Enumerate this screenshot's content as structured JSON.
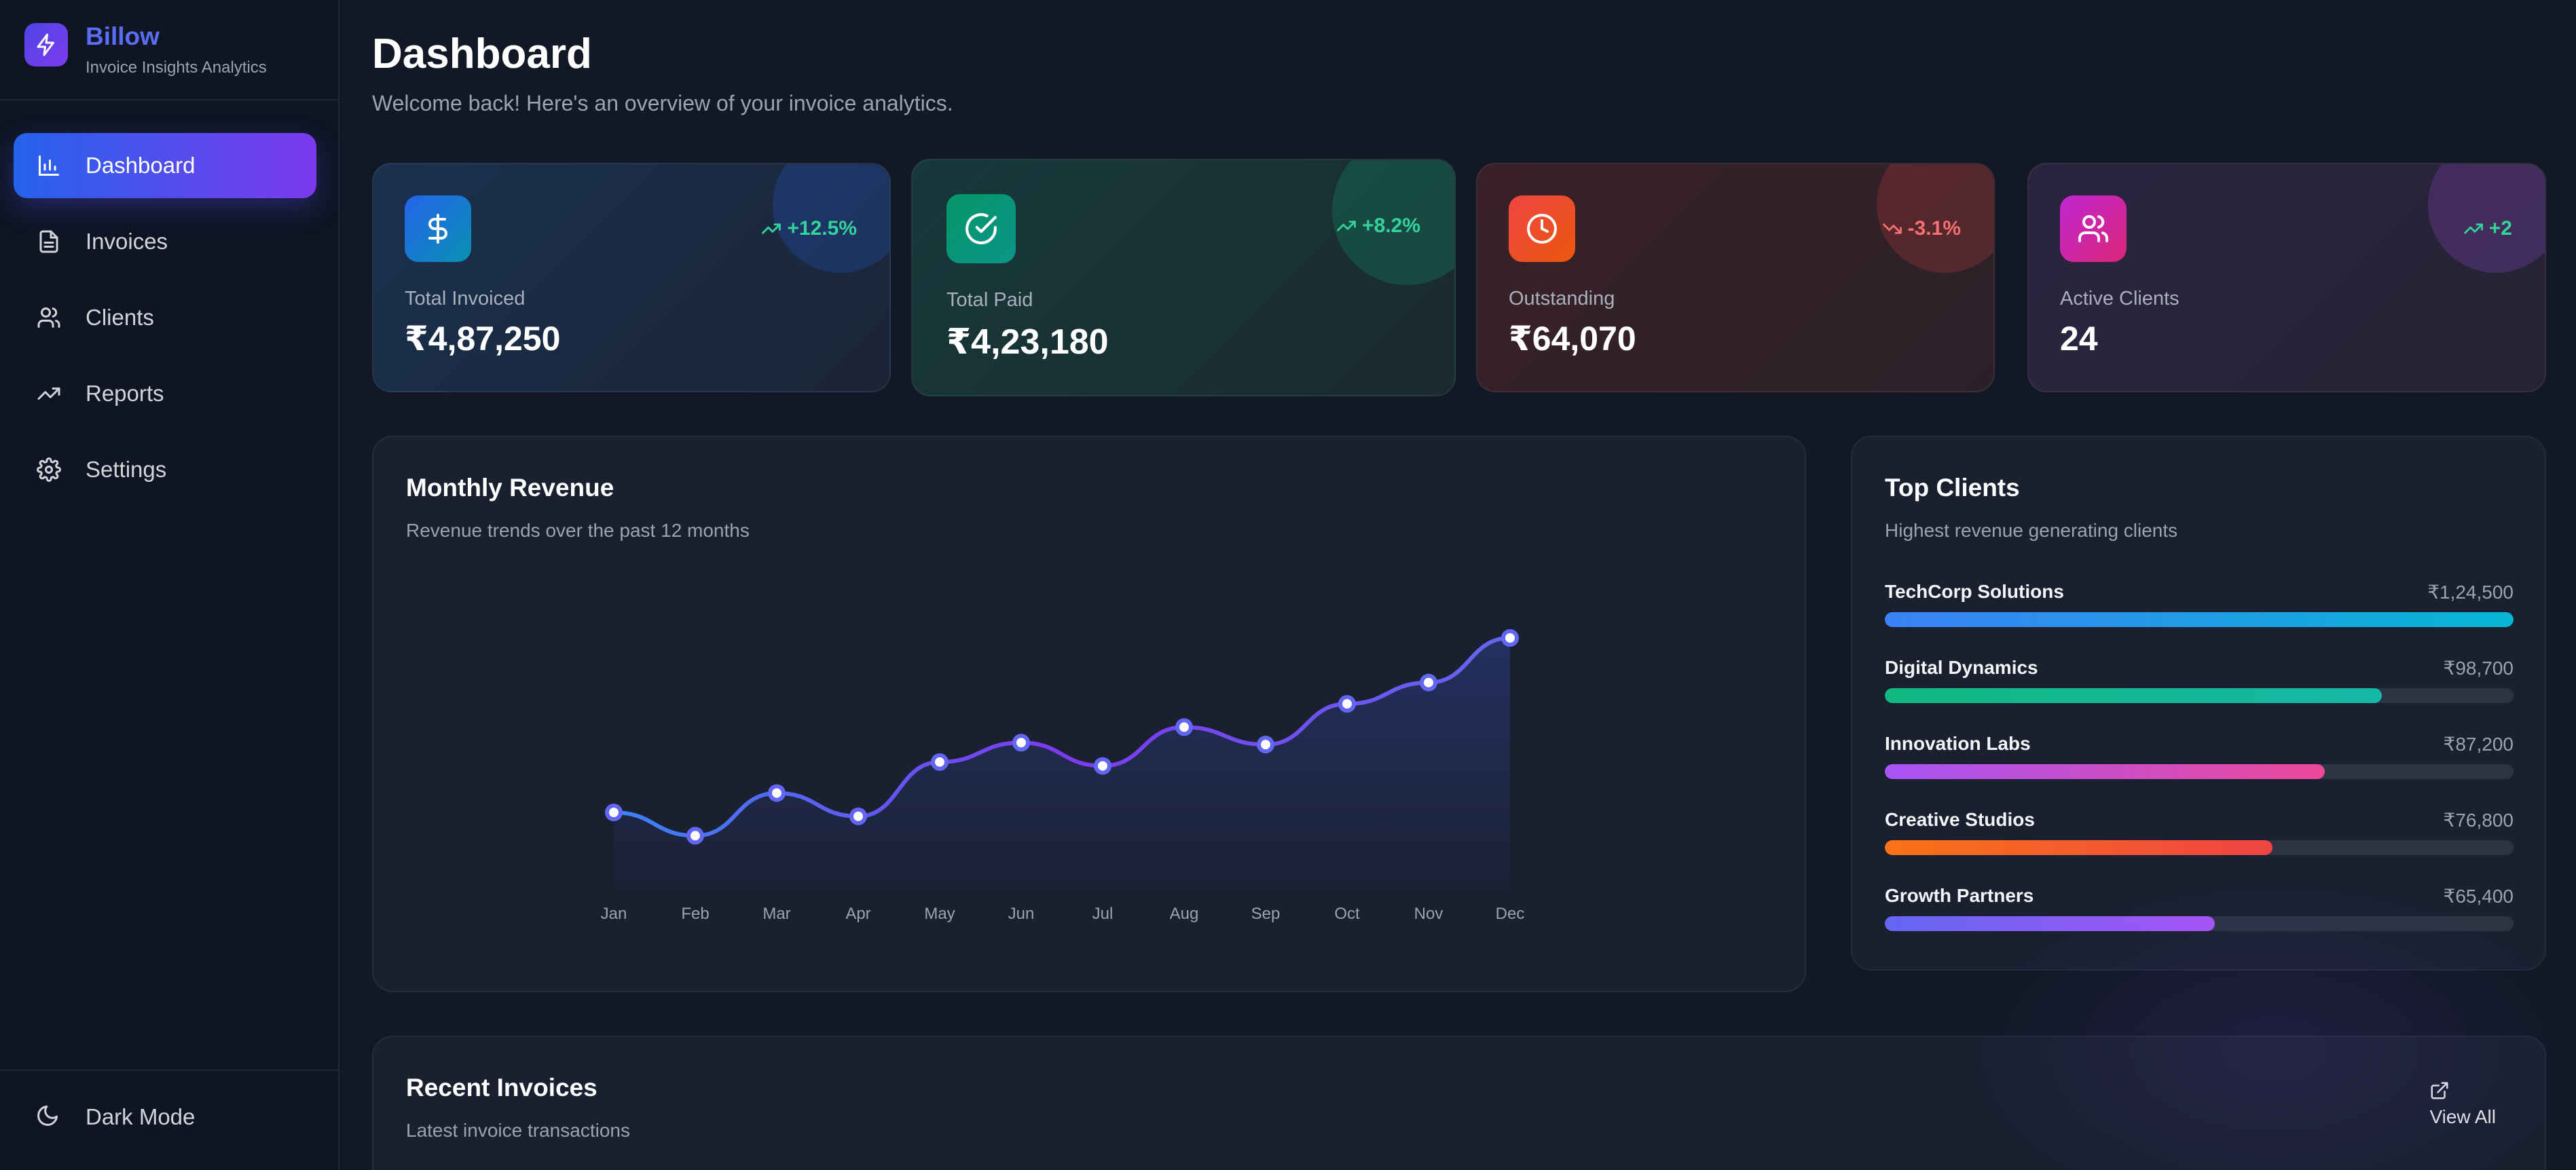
{
  "brand": {
    "name": "Billow",
    "subtitle": "Invoice Insights Analytics"
  },
  "sidebar": {
    "items": [
      {
        "label": "Dashboard",
        "icon": "bar-chart-icon",
        "active": true
      },
      {
        "label": "Invoices",
        "icon": "file-text-icon",
        "active": false
      },
      {
        "label": "Clients",
        "icon": "users-icon",
        "active": false
      },
      {
        "label": "Reports",
        "icon": "trending-up-icon",
        "active": false
      },
      {
        "label": "Settings",
        "icon": "gear-icon",
        "active": false
      }
    ],
    "dark_mode_label": "Dark Mode"
  },
  "header": {
    "title": "Dashboard",
    "subtitle": "Welcome back! Here's an overview of your invoice analytics."
  },
  "stats": [
    {
      "label": "Total Invoiced",
      "value": "₹4,87,250",
      "trend": "+12.5%",
      "trend_dir": "up",
      "icon": "dollar-icon",
      "color": "#2563eb"
    },
    {
      "label": "Total Paid",
      "value": "₹4,23,180",
      "trend": "+8.2%",
      "trend_dir": "up",
      "icon": "check-circle-icon",
      "color": "#10b981"
    },
    {
      "label": "Outstanding",
      "value": "₹64,070",
      "trend": "-3.1%",
      "trend_dir": "down",
      "icon": "clock-icon",
      "color": "#ef4444"
    },
    {
      "label": "Active Clients",
      "value": "24",
      "trend": "+2",
      "trend_dir": "up",
      "icon": "users-icon",
      "color": "#c026d3"
    }
  ],
  "revenue": {
    "title": "Monthly Revenue",
    "subtitle": "Revenue trends over the past 12 months"
  },
  "chart_data": {
    "type": "area",
    "categories": [
      "Jan",
      "Feb",
      "Mar",
      "Apr",
      "May",
      "Jun",
      "Jul",
      "Aug",
      "Sep",
      "Oct",
      "Nov",
      "Dec"
    ],
    "values": [
      48000,
      42000,
      53000,
      47000,
      61000,
      66000,
      60000,
      70000,
      65500,
      76000,
      81500,
      93000
    ],
    "title": "Monthly Revenue",
    "xlabel": "",
    "ylabel": "",
    "ylim": [
      30000,
      100000
    ],
    "grid": false,
    "color": "#6366f1"
  },
  "top_clients": {
    "title": "Top Clients",
    "subtitle": "Highest revenue generating clients",
    "items": [
      {
        "name": "TechCorp Solutions",
        "amount": "₹1,24,500",
        "fraction": 1.0,
        "from": "#3b82f6",
        "to": "#06b6d4"
      },
      {
        "name": "Digital Dynamics",
        "amount": "₹98,700",
        "fraction": 0.79,
        "from": "#10b981",
        "to": "#14b8a6"
      },
      {
        "name": "Innovation Labs",
        "amount": "₹87,200",
        "fraction": 0.7,
        "from": "#a855f7",
        "to": "#ec4899"
      },
      {
        "name": "Creative Studios",
        "amount": "₹76,800",
        "fraction": 0.617,
        "from": "#f97316",
        "to": "#ef4444"
      },
      {
        "name": "Growth Partners",
        "amount": "₹65,400",
        "fraction": 0.525,
        "from": "#6366f1",
        "to": "#a855f7"
      }
    ]
  },
  "recent": {
    "title": "Recent Invoices",
    "subtitle": "Latest invoice transactions",
    "view_all_label": "View All"
  }
}
